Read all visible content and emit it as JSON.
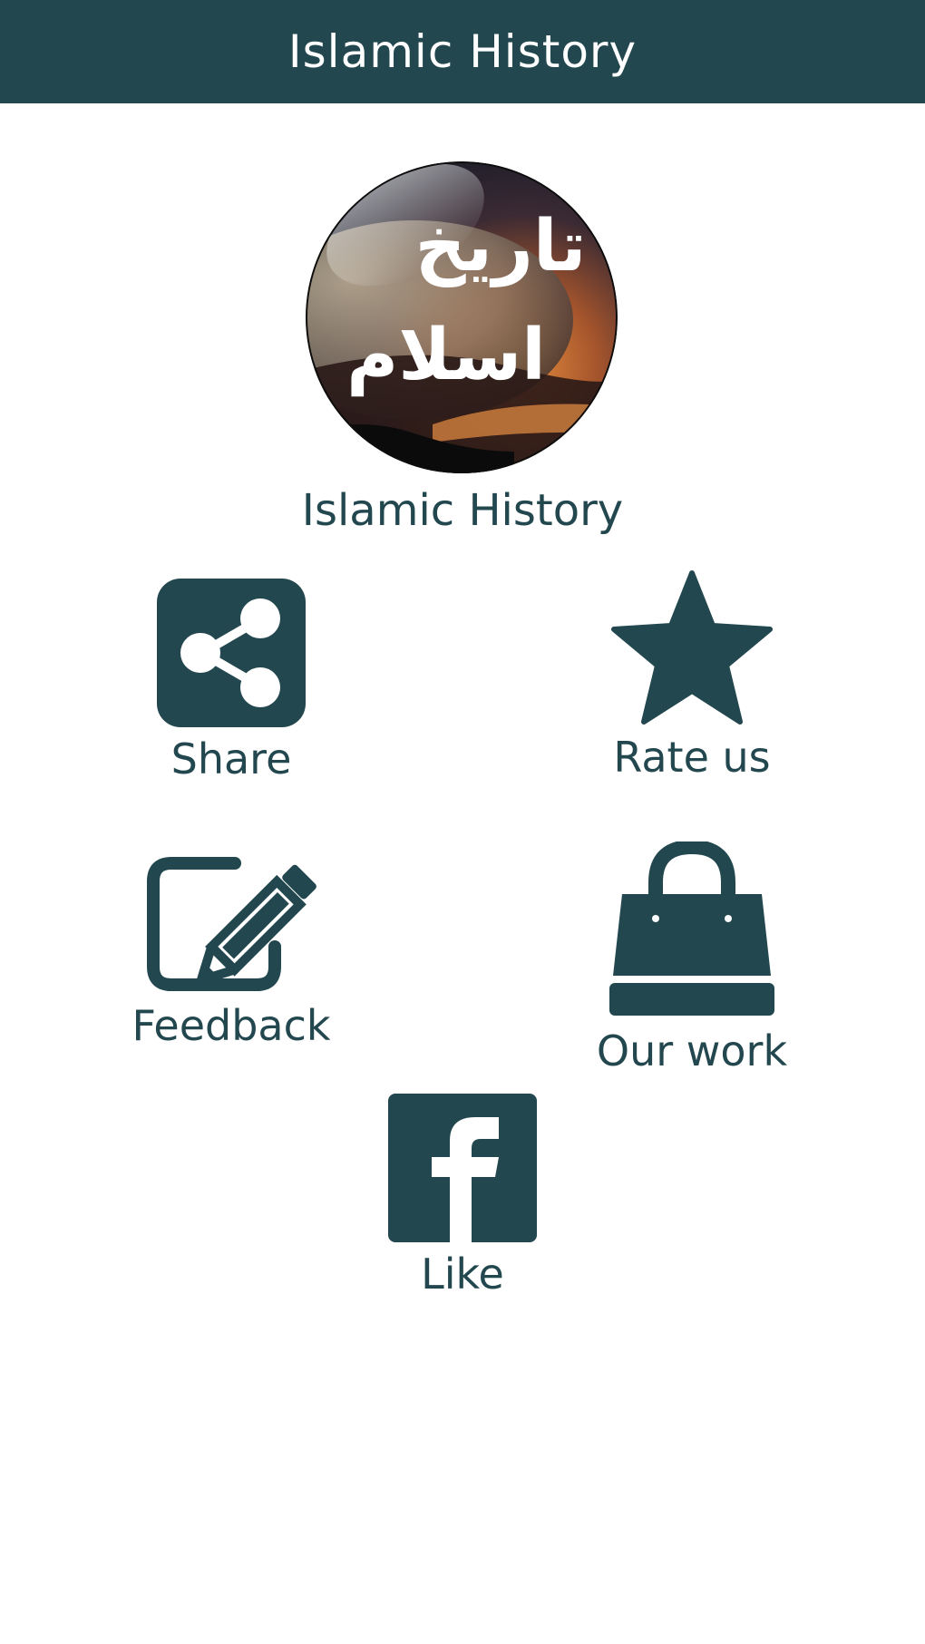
{
  "app_bar": {
    "title": "Islamic History"
  },
  "logo": {
    "arabic_line1": "تاریخ",
    "arabic_line2": "اسلام",
    "caption": "Islamic History"
  },
  "actions": {
    "share": {
      "label": "Share",
      "icon": "share-icon"
    },
    "rate": {
      "label": "Rate us",
      "icon": "star-icon"
    },
    "feedback": {
      "label": "Feedback",
      "icon": "edit-icon"
    },
    "our_work": {
      "label": "Our work",
      "icon": "shopping-bag-icon"
    },
    "like": {
      "label": "Like",
      "icon": "facebook-icon"
    }
  },
  "colors": {
    "primary": "#22474f",
    "background": "#ffffff"
  }
}
